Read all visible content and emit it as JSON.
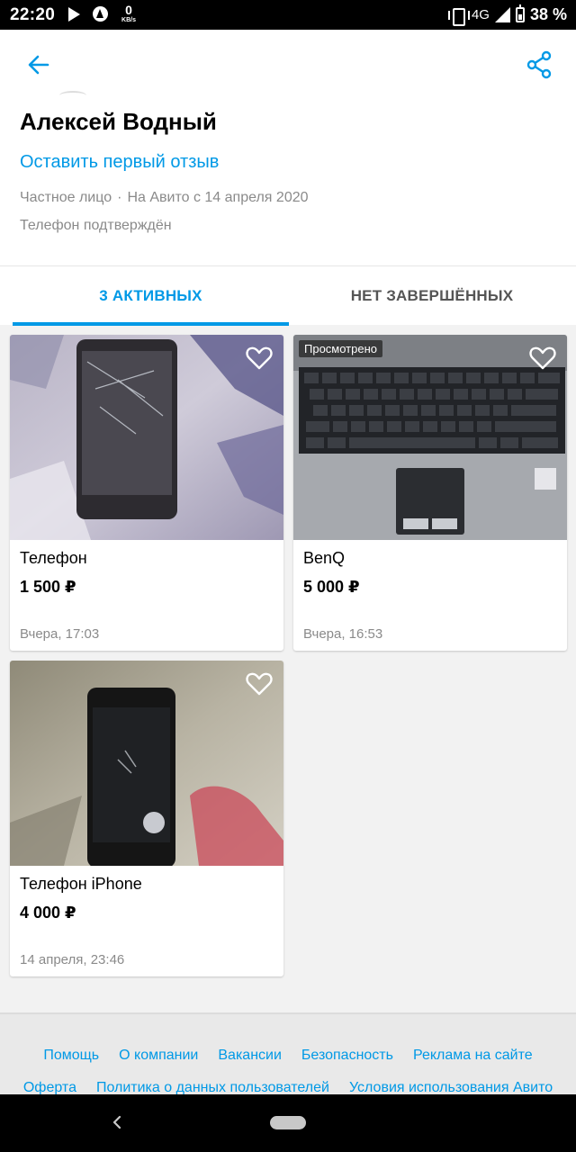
{
  "status_bar": {
    "time": "22:20",
    "speed_value": "0",
    "speed_unit": "KB/s",
    "network": "4G",
    "battery": "38 %"
  },
  "header": {
    "back_icon": "arrow-left-icon",
    "share_icon": "share-icon",
    "accent_color": "#0099e6"
  },
  "profile": {
    "name": "Алексей Водный",
    "review_link": "Оставить первый отзыв",
    "seller_type": "Частное лицо",
    "separator": "·",
    "member_since": "На Авито с 14 апреля 2020",
    "phone_status": "Телефон подтверждён"
  },
  "tabs": [
    {
      "label": "3 АКТИВНЫХ",
      "active": true
    },
    {
      "label": "НЕТ ЗАВЕРШЁННЫХ",
      "active": false
    }
  ],
  "listings": [
    {
      "title": "Телефон",
      "price": "1 500 ₽",
      "date": "Вчера, 17:03",
      "viewed_label": ""
    },
    {
      "title": "BenQ",
      "price": "5 000 ₽",
      "date": "Вчера, 16:53",
      "viewed_label": "Просмотрено"
    },
    {
      "title": "Телефон iPhone",
      "price": "4 000 ₽",
      "date": "14 апреля, 23:46",
      "viewed_label": ""
    }
  ],
  "footer": {
    "row1": [
      "Помощь",
      "О компании",
      "Вакансии",
      "Безопасность",
      "Реклама на сайте"
    ],
    "row2": [
      "Оферта",
      "Политика о данных пользователей",
      "Условия использования Авито"
    ]
  }
}
